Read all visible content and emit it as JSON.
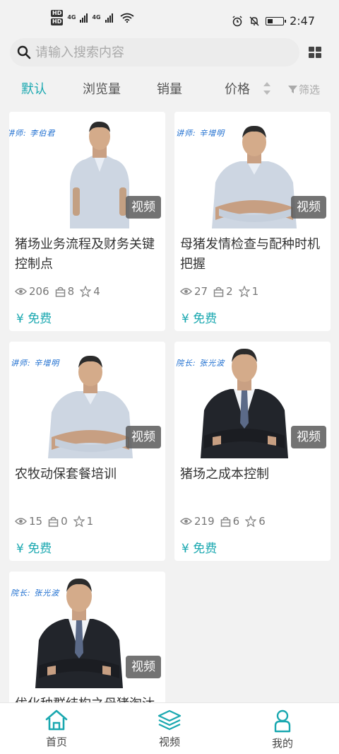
{
  "status_bar": {
    "hd1": "HD",
    "hd2": "HD",
    "net1": "4G",
    "net2": "4G",
    "time": "2:47"
  },
  "search": {
    "placeholder": "请输入搜索内容"
  },
  "tabs": [
    {
      "label": "默认",
      "active": true
    },
    {
      "label": "浏览量",
      "active": false
    },
    {
      "label": "销量",
      "active": false
    },
    {
      "label": "价格",
      "active": false
    }
  ],
  "filter_label": "筛选",
  "accent_color": "#1aa8b0",
  "cards": [
    {
      "caption": "讲师: 李伯君",
      "badge": "视频",
      "title": "猪场业务流程及财务关键控制点",
      "views": "206",
      "sales": "8",
      "stars": "4",
      "price": "¥ 免费"
    },
    {
      "caption": "讲师: 辛增明",
      "badge": "视频",
      "title": "母猪发情检查与配种时机把握",
      "views": "27",
      "sales": "2",
      "stars": "1",
      "price": "¥ 免费"
    },
    {
      "caption": "讲师: 辛增明",
      "badge": "视频",
      "title": "农牧动保套餐培训",
      "views": "15",
      "sales": "0",
      "stars": "1",
      "price": "¥ 免费"
    },
    {
      "caption": "院长: 张光波",
      "badge": "视频",
      "title": "猪场之成本控制",
      "views": "219",
      "sales": "6",
      "stars": "6",
      "price": "¥ 免费"
    },
    {
      "caption": "院长: 张光波",
      "badge": "视频",
      "title": "优化种群结构之母猪淘汰",
      "views": "",
      "sales": "",
      "stars": "",
      "price": ""
    }
  ],
  "bottom_nav": [
    {
      "label": "首页",
      "icon": "home-icon"
    },
    {
      "label": "视频",
      "icon": "layers-icon"
    },
    {
      "label": "我的",
      "icon": "user-icon"
    }
  ]
}
